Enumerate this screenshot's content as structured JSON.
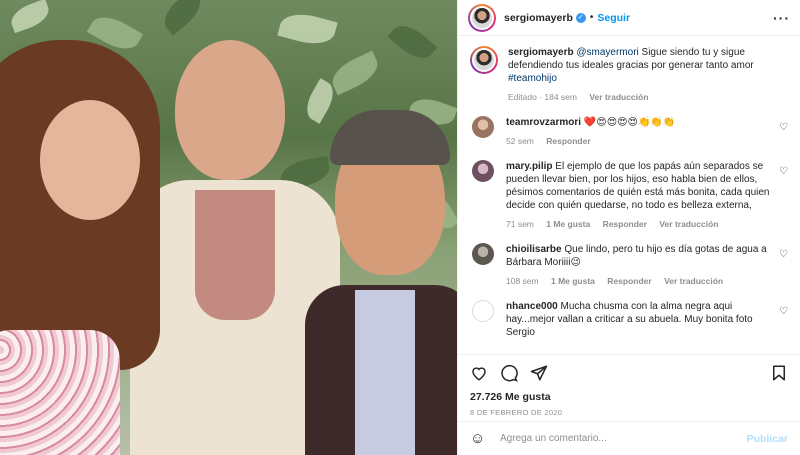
{
  "post": {
    "username": "sergiomayerb",
    "follow_label": "Seguir",
    "more_label": "···",
    "caption": {
      "mention": "@smayermori",
      "text": " Sigue siendo tu y sigue defendiendo tus ideales gracias por generar tanto amor ",
      "hashtag": "#teamohijo",
      "edited": "Editado · 184 sem",
      "translate": "Ver traducción"
    },
    "comments": [
      {
        "user": "teamrovzarmori",
        "text": "❤️😍😍😍😍👏👏👏",
        "time": "52 sem",
        "likes": "",
        "reply": "Responder",
        "translate": "",
        "avatar_color": "#c9a38f"
      },
      {
        "user": "mary.pilip",
        "text": "El ejemplo de que los papás aún separados se pueden llevar bien, por los hijos, eso habla bien de ellos, pésimos comentarios de quién está más bonita, cada quien decide con quién quedarse, no todo es belleza externa,",
        "time": "71 sem",
        "likes": "1 Me gusta",
        "reply": "Responder",
        "translate": "Ver traducción",
        "avatar_color": "#8a6d7b"
      },
      {
        "user": "chioilisarbe",
        "text": "Que lindo, pero tu hijo es día gotas de agua a Bárbara Moriiii😉",
        "time": "108 sem",
        "likes": "1 Me gusta",
        "reply": "Responder",
        "translate": "Ver traducción",
        "avatar_color": "#6f6a62"
      },
      {
        "user": "nhance000",
        "text": "Mucha chusma con la alma negra aqui hay...mejor vallan a criticar a su abuela. Muy bonita foto Sergio",
        "time": "",
        "likes": "",
        "reply": "",
        "translate": "",
        "avatar_color": "#ffffff"
      }
    ],
    "likes": "27.726 Me gusta",
    "date": "8 DE FEBRERO DE 2020",
    "add_comment_placeholder": "Agrega un comentario...",
    "publish_label": "Publicar",
    "emoji_icon": "☺",
    "heart_icon": "♡"
  }
}
